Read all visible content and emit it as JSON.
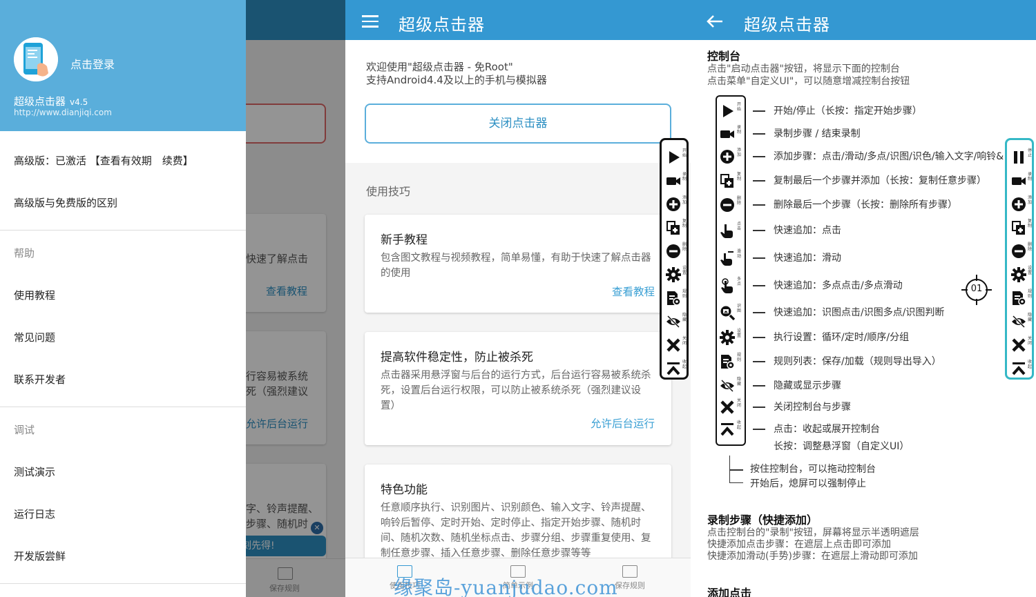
{
  "colors": {
    "primary": "#3498d2",
    "drawer_header": "#5aaedb",
    "link": "#3ba0d4",
    "accent_cyan": "#35b8c6"
  },
  "panel1": {
    "background": {
      "card1_text": "快速了解点击",
      "card1_link": "查看教程",
      "card2_text1": "行容易被系统",
      "card2_text2": "死（强烈建议",
      "card2_link": "允许后台运行",
      "card3_text1": "字、铃声提醒、",
      "card3_text2": "步骤、随机时",
      "card3_btn": "刻先得!",
      "nav_label": "保存规则"
    },
    "drawer": {
      "login": "点击登录",
      "app_name": "超级点击器",
      "version": "v4.5",
      "url": "http://www.dianjiqi.com",
      "premium_status": "高级版：已激活 【查看有效期　续费】",
      "compare": "高级版与免费版的区别",
      "section_help": "帮助",
      "tutorial": "使用教程",
      "faq": "常见问题",
      "contact": "联系开发者",
      "section_debug": "调试",
      "demo": "测试演示",
      "log": "运行日志",
      "dev_preview": "开发版尝鲜"
    }
  },
  "panel2": {
    "title": "超级点击器",
    "welcome_line1": "欢迎使用\"超级点击器 - 免Root\"",
    "welcome_line2": "支持Android4.4及以上的手机与模拟器",
    "close_button": "关闭点击器",
    "tips_label": "使用技巧",
    "cards": [
      {
        "title": "新手教程",
        "desc": "包含图文教程与视频教程，简单易懂，有助于快速了解点击器的使用",
        "link": "查看教程"
      },
      {
        "title": "提高软件稳定性，防止被杀死",
        "desc": "点击器采用悬浮窗与后台的运行方式，后台运行容易被系统杀死，设置后台运行权限，可以防止被系统杀死（强烈建议设置）",
        "link": "允许后台运行"
      },
      {
        "title": "特色功能",
        "desc": "任意顺序执行、识别图片、识别颜色、输入文字、铃声提醒、响铃后暂停、定时开始、定时停止、指定开始步骤、随机时间、随机次数、随机坐标点击、步骤分组、步骤重复使用、复制任意步骤、插入任意步骤、删除任意步骤等等",
        "link": ""
      }
    ],
    "nav": [
      "使用技巧",
      "简单示例",
      "保存规则"
    ],
    "watermark": "缘聚岛-yuanjudao.com"
  },
  "float_bar": {
    "buttons": [
      {
        "icon": "play-icon",
        "label": "开始"
      },
      {
        "icon": "record-icon",
        "label": "录制"
      },
      {
        "icon": "add-icon",
        "label": "添加"
      },
      {
        "icon": "copy-icon",
        "label": "复制"
      },
      {
        "icon": "remove-icon",
        "label": "删除"
      },
      {
        "icon": "gear-icon",
        "label": "设置"
      },
      {
        "icon": "rules-icon",
        "label": "规则"
      },
      {
        "icon": "eye-off-icon",
        "label": "隐藏"
      },
      {
        "icon": "close-icon",
        "label": "关闭"
      },
      {
        "icon": "collapse-icon",
        "label": "收起"
      }
    ],
    "pause_label": "停止",
    "target_label": "01"
  },
  "panel3": {
    "title": "超级点击器",
    "section1_title": "控制台",
    "section1_line1": "点击\"启动点击器\"按钮，将显示下面的控制台",
    "section1_line2": "点击菜单\"自定义UI\"，可以随意增减控制台按钮",
    "controls": [
      {
        "icon": "play-icon",
        "label": "开始",
        "desc": "开始/停止（长按：指定开始步骤）"
      },
      {
        "icon": "record-icon",
        "label": "录制",
        "desc": "录制步骤 / 结束录制"
      },
      {
        "icon": "add-icon",
        "label": "添加",
        "desc": "添加步骤：点击/滑动/多点/识图/识色/输入文字/响铃&"
      },
      {
        "icon": "copy-icon",
        "label": "复制",
        "desc": "复制最后一个步骤并添加（长按：复制任意步骤）"
      },
      {
        "icon": "remove-icon",
        "label": "删除",
        "desc": "删除最后一个步骤（长按：删除所有步骤）"
      },
      {
        "icon": "tap-icon",
        "label": "点击",
        "desc": "快速追加：点击"
      },
      {
        "icon": "swipe-icon",
        "label": "滑动",
        "desc": "快速追加：滑动"
      },
      {
        "icon": "multitouch-icon",
        "label": "多点",
        "desc": "快速追加：多点点击/多点滑动"
      },
      {
        "icon": "image-search-icon",
        "label": "识图",
        "desc": "快速追加：识图点击/识图多点/识图判断"
      },
      {
        "icon": "gear-icon",
        "label": "设置",
        "desc": "执行设置：循环/定时/顺序/分组"
      },
      {
        "icon": "rules-icon",
        "label": "规则",
        "desc": "规则列表：保存/加载（规则导出导入）"
      },
      {
        "icon": "eye-off-icon",
        "label": "隐藏",
        "desc": "隐藏或显示步骤"
      },
      {
        "icon": "close-icon",
        "label": "关闭",
        "desc": "关闭控制台与步骤"
      },
      {
        "icon": "collapse-icon",
        "label": "收起",
        "desc": "点击：收起或展开控制台"
      }
    ],
    "collapse_desc2": "长按：调整悬浮窗（自定义UI）",
    "note1": "按住控制台，可以拖动控制台",
    "note2": "开始后，熄屏可以强制停止",
    "section2_title": "录制步骤（快捷添加）",
    "section2_line1": "点击控制台的\"录制\"按钮，屏幕将显示半透明遮层",
    "section2_line2": "快捷添加点击步骤：在遮层上点击即可添加",
    "section2_line3": "快捷添加滑动(手势)步骤：在遮层上滑动即可添加",
    "section3_title": "添加点击"
  }
}
